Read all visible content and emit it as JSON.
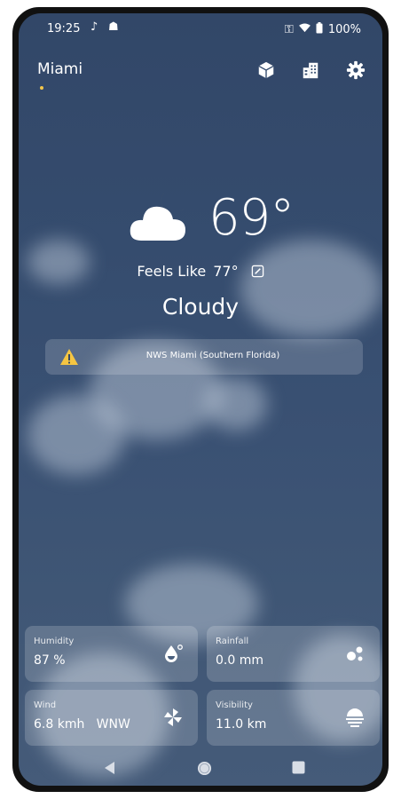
{
  "status": {
    "time": "19:25",
    "battery": "100%",
    "icons": [
      "tiktok-icon",
      "cat-icon",
      "key-icon",
      "wifi-icon",
      "battery-icon"
    ]
  },
  "header": {
    "city": "Miami",
    "icons": [
      "cube-icon",
      "buildings-icon",
      "gear-icon"
    ]
  },
  "weather": {
    "temperature": "69°",
    "feels_label": "Feels Like",
    "feels_value": "77°",
    "condition": "Cloudy",
    "icon": "partly-cloudy-night-icon"
  },
  "alert": {
    "text": "NWS Miami (Southern Florida)",
    "icon": "warning-icon",
    "color": "#f5c542"
  },
  "cards": [
    {
      "label": "Humidity",
      "value": "87 %",
      "icon": "humidity-drop-icon"
    },
    {
      "label": "Rainfall",
      "value": "0.0 mm",
      "icon": "rain-drops-icon"
    },
    {
      "label": "Wind",
      "value": "6.8 kmh   WNW",
      "icon": "pinwheel-icon"
    },
    {
      "label": "Visibility",
      "value": "11.0 km",
      "icon": "fog-sun-icon"
    }
  ],
  "navbar": {
    "icons": [
      "back-icon",
      "home-icon",
      "recents-icon"
    ]
  }
}
